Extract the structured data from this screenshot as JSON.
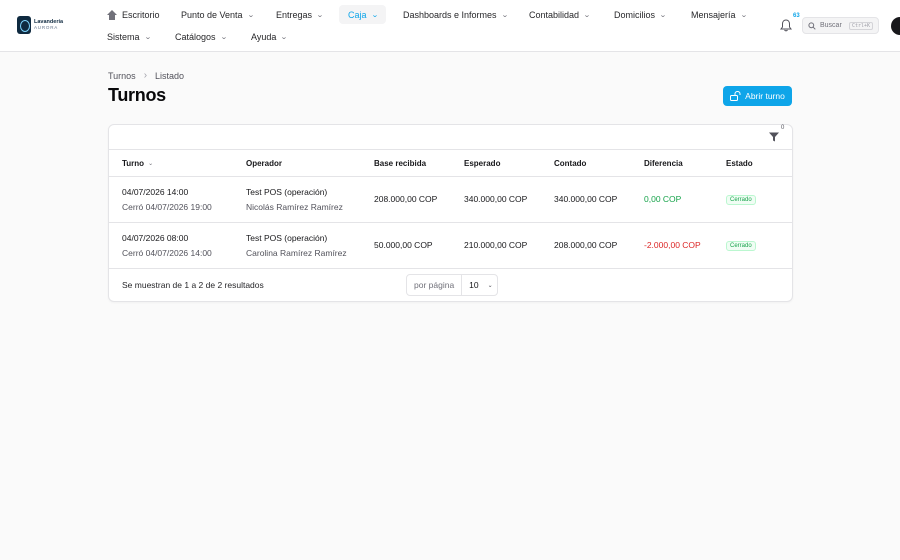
{
  "brand": {
    "line1": "Lavandería",
    "line2": "AURORA"
  },
  "nav": {
    "row1": [
      {
        "label": "Escritorio",
        "icon": "home-icon",
        "dropdown": false
      },
      {
        "label": "Punto de Venta",
        "dropdown": true
      },
      {
        "label": "Entregas",
        "dropdown": true
      },
      {
        "label": "Caja",
        "dropdown": true,
        "active": true
      },
      {
        "label": "Dashboards e Informes",
        "dropdown": true
      },
      {
        "label": "Contabilidad",
        "dropdown": true
      },
      {
        "label": "Domicilios",
        "dropdown": true
      },
      {
        "label": "Mensajería",
        "dropdown": true
      }
    ],
    "row2": [
      {
        "label": "Sistema",
        "dropdown": true
      },
      {
        "label": "Catálogos",
        "dropdown": true
      },
      {
        "label": "Ayuda",
        "dropdown": true
      }
    ],
    "chevron": "⌄"
  },
  "notifications": {
    "count": "63",
    "icon": "bell-icon"
  },
  "search": {
    "label": "Buscar",
    "shortcut": "Ctrl+K",
    "icon": "search-icon"
  },
  "breadcrumb": {
    "items": [
      "Turnos",
      "Listado"
    ],
    "separator": "›"
  },
  "page": {
    "title": "Turnos"
  },
  "actions": {
    "open_shift": "Abrir turno",
    "open_shift_icon": "lock-open-icon"
  },
  "filters": {
    "count": "0",
    "icon": "filter-icon"
  },
  "table": {
    "columns": [
      "Turno",
      "Operador",
      "Base recibida",
      "Esperado",
      "Contado",
      "Diferencia",
      "Estado"
    ],
    "sort_chevron": "⌄",
    "rows": [
      {
        "opened": "04/07/2026 14:00",
        "closed": "Cerró 04/07/2026 19:00",
        "pos": "Test POS (operación)",
        "operator": "Nicolás Ramírez Ramírez",
        "base": "208.000,00 COP",
        "expected": "340.000,00 COP",
        "counted": "340.000,00 COP",
        "difference": "0,00 COP",
        "difference_sign": "positive",
        "status": "Cerrado"
      },
      {
        "opened": "04/07/2026 08:00",
        "closed": "Cerró 04/07/2026 14:00",
        "pos": "Test POS (operación)",
        "operator": "Carolina Ramírez Ramírez",
        "base": "50.000,00 COP",
        "expected": "210.000,00 COP",
        "counted": "208.000,00 COP",
        "difference": "-2.000,00 COP",
        "difference_sign": "negative",
        "status": "Cerrado"
      }
    ]
  },
  "pagination": {
    "summary": "Se muestran de 1 a 2 de 2 resultados",
    "per_page_label": "por página",
    "per_page_value": "10"
  },
  "colors": {
    "accent": "#0ea5e9",
    "positive": "#16a34a",
    "negative": "#dc2626"
  }
}
